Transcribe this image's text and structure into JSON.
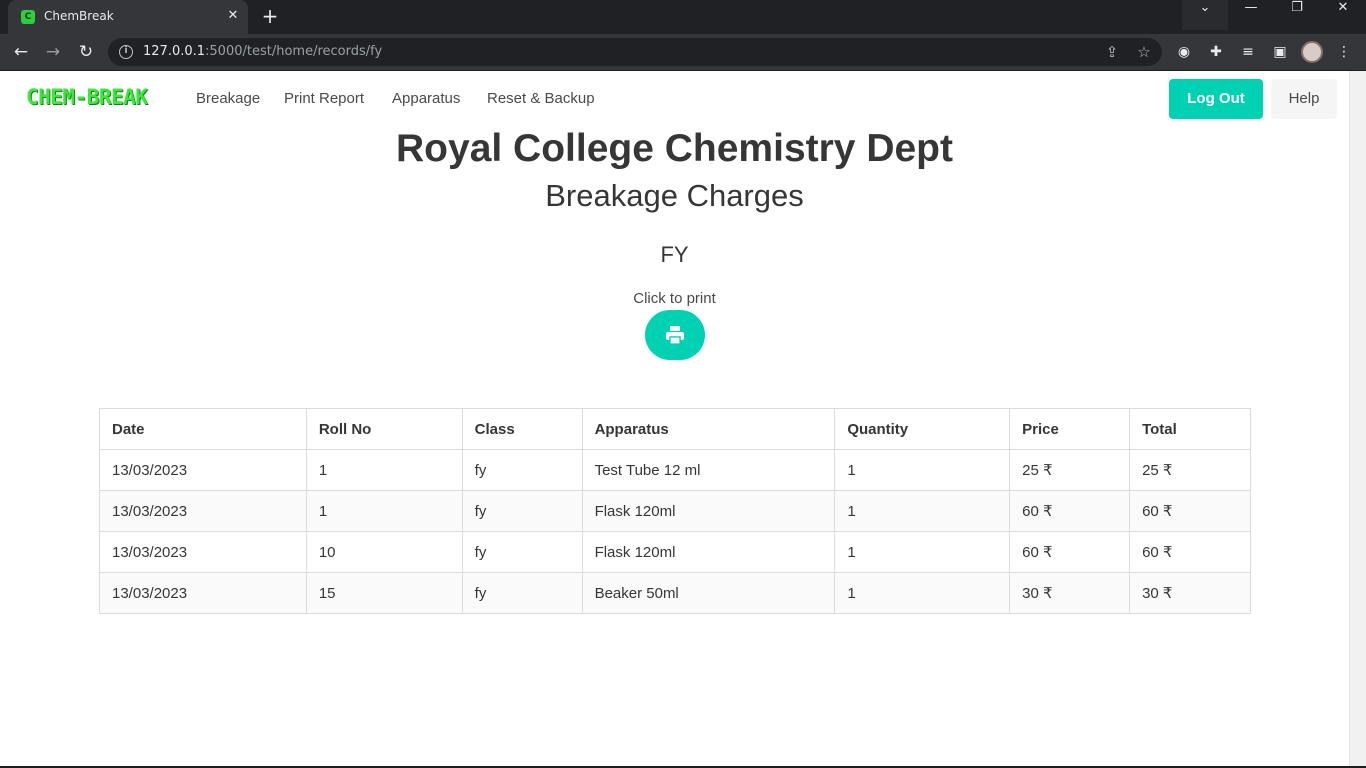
{
  "browser": {
    "tab_title": "ChemBreak",
    "tab_favicon": "C",
    "tab_close": "✕",
    "new_tab": "+",
    "url_host": "127.0.0.1",
    "url_path": ":5000/test/home/records/fy"
  },
  "colors": {
    "brand": "#39e83b",
    "primary": "#00d1b2",
    "text": "#363636"
  },
  "navbar": {
    "brand": "CHEM-BREAK",
    "links": [
      "Breakage",
      "Print Report",
      "Apparatus",
      "Reset & Backup"
    ],
    "logout_label": "Log Out",
    "help_label": "Help"
  },
  "header": {
    "title": "Royal College Chemistry Dept",
    "subtitle": "Breakage Charges",
    "class_label": "FY",
    "print_hint": "Click to print"
  },
  "icons": {
    "print": "printer-icon",
    "back": "arrow-left-icon",
    "forward": "arrow-right-icon",
    "reload": "reload-icon",
    "info": "info-icon",
    "share": "share-icon",
    "bookmark": "star-icon",
    "extensions": "puzzle-icon"
  },
  "table": {
    "headers": [
      "Date",
      "Roll No",
      "Class",
      "Apparatus",
      "Quantity",
      "Price",
      "Total"
    ],
    "rows": [
      [
        "13/03/2023",
        "1",
        "fy",
        "Test Tube 12 ml",
        "1",
        "25 ₹",
        "25 ₹"
      ],
      [
        "13/03/2023",
        "1",
        "fy",
        "Flask 120ml",
        "1",
        "60 ₹",
        "60 ₹"
      ],
      [
        "13/03/2023",
        "10",
        "fy",
        "Flask 120ml",
        "1",
        "60 ₹",
        "60 ₹"
      ],
      [
        "13/03/2023",
        "15",
        "fy",
        "Beaker 50ml",
        "1",
        "30 ₹",
        "30 ₹"
      ]
    ]
  }
}
